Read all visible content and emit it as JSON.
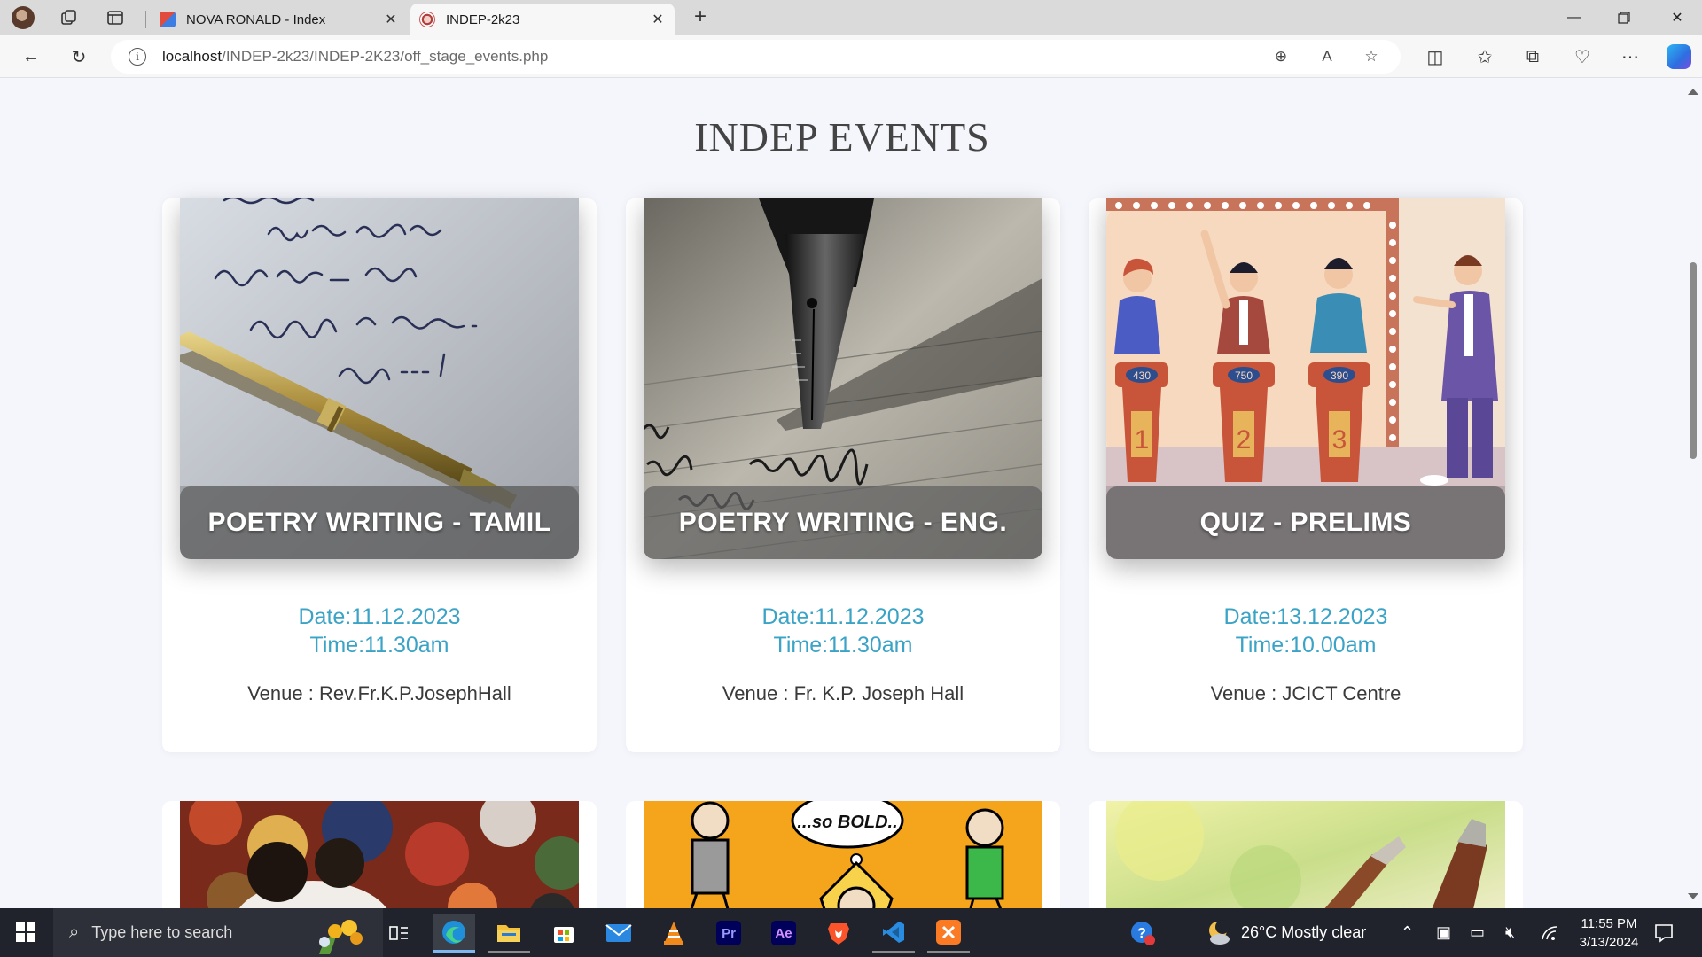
{
  "browser": {
    "tabs": [
      {
        "title": "NOVA RONALD - Index",
        "active": false
      },
      {
        "title": "INDEP-2k23",
        "active": true
      }
    ],
    "url_host": "localhost",
    "url_path": "/INDEP-2k23/INDEP-2K23/off_stage_events.php"
  },
  "page": {
    "title": "INDEP EVENTS",
    "events": [
      {
        "name": "POETRY WRITING - TAMIL",
        "date": "Date:11.12.2023",
        "time": "Time:11.30am",
        "venue": "Venue : Rev.Fr.K.P.JosephHall"
      },
      {
        "name": "POETRY WRITING - ENG.",
        "date": "Date:11.12.2023",
        "time": "Time:11.30am",
        "venue": "Venue : Fr. K.P. Joseph Hall"
      },
      {
        "name": "QUIZ - PRELIMS",
        "date": "Date:13.12.2023",
        "time": "Time:10.00am",
        "venue": "Venue : JCICT Centre"
      }
    ],
    "quiz_scores": [
      "430",
      "750",
      "390"
    ],
    "quiz_podiums": [
      "1",
      "2",
      "3"
    ],
    "comic_text": "...so BOLD.."
  },
  "taskbar": {
    "search_placeholder": "Type here to search",
    "weather": "26°C  Mostly clear",
    "time": "11:55 PM",
    "date": "3/13/2024",
    "apps": [
      "task-view-icon",
      "edge-icon",
      "file-explorer-icon",
      "store-icon",
      "mail-icon",
      "vlc-icon",
      "premiere-pro-icon",
      "after-effects-icon",
      "brave-icon",
      "vscode-icon",
      "xampp-icon"
    ],
    "app_labels": {
      "premiere": "Pr",
      "after_effects": "Ae"
    }
  },
  "colors": {
    "accent_text": "#3aa3c6",
    "page_bg": "#f4f6fb",
    "taskbar_bg": "#20232b"
  }
}
